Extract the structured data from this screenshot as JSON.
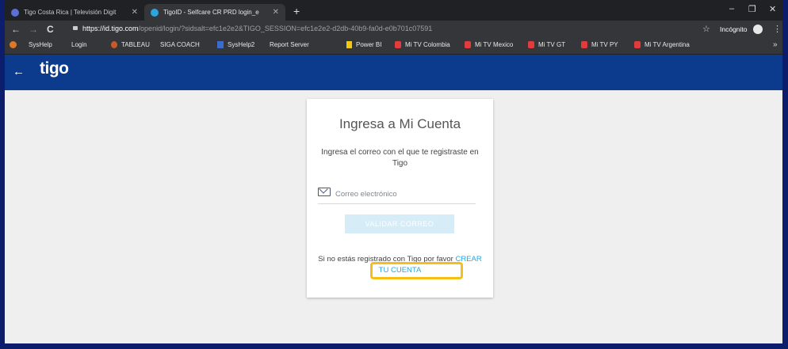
{
  "browser": {
    "tabs": [
      {
        "label": "Tigo Costa Rica | Televisión Digit",
        "favicon_color": "#5b6fd6"
      },
      {
        "label": "TigoID - Selfcare CR PRD login_e",
        "favicon_color": "#2aa6dd"
      }
    ],
    "new_tab": "+",
    "window_controls": {
      "minimize": "–",
      "restore": "❐",
      "close": "✕"
    },
    "nav": {
      "back": "←",
      "forward": "→",
      "reload": "C"
    },
    "address": {
      "host": "https://id.tigo.com",
      "path": "/openid/login/?sidsalt=efc1e2e2&TIGO_SESSION=efc1e2e2-d2db-40b9-fa0d-e0b701c07591"
    },
    "star": "☆",
    "incognito_label": "Incógnito",
    "menu": "⋮",
    "bookmarks": [
      {
        "label": "SysHelp",
        "icon": "page-icon"
      },
      {
        "label": "Login",
        "icon": "page-icon"
      },
      {
        "label": "TABLEAU",
        "icon": "tableau-icon"
      },
      {
        "label": "SIGA COACH",
        "icon": "page-icon"
      },
      {
        "label": "SysHelp2",
        "icon": "folder-icon"
      },
      {
        "label": "Report Server",
        "icon": "page-icon"
      },
      {
        "label": "Power BI",
        "icon": "powerbi-icon"
      },
      {
        "label": "Mi TV Colombia",
        "icon": "mitv-icon"
      },
      {
        "label": "Mi TV Mexico",
        "icon": "mitv-icon"
      },
      {
        "label": "Mi TV GT",
        "icon": "mitv-icon"
      },
      {
        "label": "Mi TV PY",
        "icon": "mitv-icon"
      },
      {
        "label": "Mi TV Argentina",
        "icon": "mitv-icon"
      }
    ],
    "bookmarks_more": "»"
  },
  "header": {
    "back": "←",
    "logo": "tigo",
    "bg_color": "#0c3a8c"
  },
  "card": {
    "title": "Ingresa a Mi Cuenta",
    "subtitle": "Ingresa el correo con el que te registraste en Tigo",
    "email_placeholder": "Correo electrónico",
    "validate_label": "VALIDAR CORREO",
    "signup_prefix": "Si no estás registrado con Tigo por favor ",
    "create_account_label": "CREAR TU CUENTA",
    "link_color": "#2aa6dd",
    "highlight_color": "#f5bf18"
  }
}
